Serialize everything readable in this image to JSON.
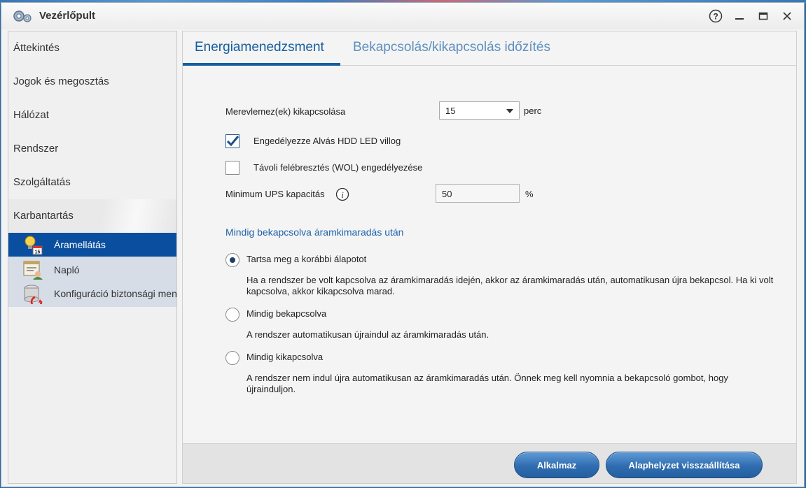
{
  "window": {
    "title": "Vezérlőpult",
    "icons": {
      "app": "gears-icon",
      "help": "help-circle-icon",
      "minimize": "minimize-icon",
      "maximize": "maximize-icon",
      "close": "close-icon"
    }
  },
  "sidebar": {
    "items": [
      {
        "label": "Áttekintés"
      },
      {
        "label": "Jogok és megosztás"
      },
      {
        "label": "Hálózat"
      },
      {
        "label": "Rendszer"
      },
      {
        "label": "Szolgáltatás"
      },
      {
        "label": "Karbantartás"
      }
    ],
    "subitems": [
      {
        "label": "Áramellátás",
        "icon": "power-bulb-icon",
        "active": true
      },
      {
        "label": "Napló",
        "icon": "log-icon",
        "active": false
      },
      {
        "label": "Konfiguráció biztonsági mentése",
        "icon": "config-backup-icon",
        "active": false
      }
    ]
  },
  "tabs": [
    {
      "label": "Energiamenedzsment",
      "active": true
    },
    {
      "label": "Bekapcsolás/kikapcsolás időzítés",
      "active": false
    }
  ],
  "form": {
    "hdd_label": "Merevlemez(ek) kikapcsolása",
    "hdd_value": "15",
    "hdd_unit": "perc",
    "led_label": "Engedélyezze Alvás HDD LED villog",
    "led_checked": true,
    "wol_label": "Távoli felébresztés (WOL) engedélyezése",
    "wol_checked": false,
    "ups_label": "Minimum UPS kapacitás",
    "ups_value": "50",
    "ups_unit": "%",
    "section_title": "Mindig bekapcsolva áramkimaradás után",
    "options": [
      {
        "label": "Tartsa meg a korábbi álapotot",
        "checked": true,
        "desc": "Ha a rendszer be volt kapcsolva az áramkimaradás idején, akkor az áramkimaradás után, automatikusan újra bekapcsol. Ha ki volt kapcsolva, akkor kikapcsolva marad."
      },
      {
        "label": "Mindig bekapcsolva",
        "checked": false,
        "desc": "A rendszer automatikusan újraindul az áramkimaradás után."
      },
      {
        "label": "Mindig kikapcsolva",
        "checked": false,
        "desc": "A rendszer nem indul újra automatikusan az áramkimaradás után. Önnek meg kell nyomnia a bekapcsoló gombot, hogy újrainduljon."
      }
    ]
  },
  "footer": {
    "apply_label": "Alkalmaz",
    "reset_label": "Alaphelyzet visszaállítása"
  },
  "colors": {
    "accent": "#155d9e",
    "active_item": "#0a4f9f",
    "button": "#2f6db0"
  }
}
